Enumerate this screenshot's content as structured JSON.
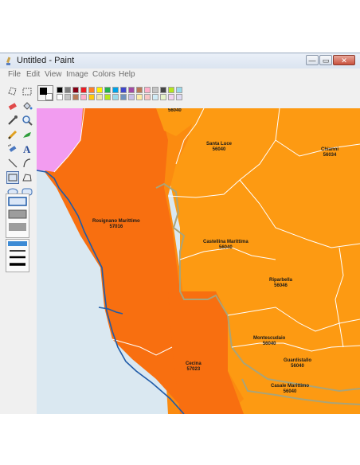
{
  "window": {
    "title": "Untitled - Paint",
    "controls": {
      "minimize": "—",
      "maximize": "▭",
      "close": "✕"
    }
  },
  "menu": [
    "File",
    "Edit",
    "View",
    "Image",
    "Colors",
    "Help"
  ],
  "palette": {
    "foreground": "#000000",
    "background": "#ffffff",
    "row1": [
      "#000000",
      "#7f7f7f",
      "#880015",
      "#ed1c24",
      "#ff7f27",
      "#fff200",
      "#22b14c",
      "#00a2e8",
      "#3f48cc",
      "#a349a4",
      "#b97a57",
      "#ffaec9",
      "#c3c3c3",
      "#464646",
      "#b5e61d",
      "#99d9ea"
    ],
    "row2": [
      "#ffffff",
      "#c3c3c3",
      "#b97a57",
      "#ffaec9",
      "#ffc90e",
      "#efe4b0",
      "#b5e61d",
      "#99d9ea",
      "#7092be",
      "#c8bfe7",
      "#fdeca6",
      "#f7c5c5",
      "#d0ecf7",
      "#e6f3c8",
      "#f2d2f0",
      "#ddd9f3"
    ]
  },
  "colors": {
    "sea": "#dae8f1",
    "pink": "#f29cf0",
    "dark_orange": "#f86f10",
    "mid_orange": "#fb8b10",
    "light_orange": "#fd9a12",
    "border_gray": "#a9a479",
    "border_white": "#ffffff",
    "coast_blue": "#1f5ba8"
  },
  "map": {
    "labels": [
      {
        "name": "Rosignano Marittimo",
        "code": "57016"
      },
      {
        "name": "Santa Luce",
        "code": "56040"
      },
      {
        "name": "Chianni",
        "code": "56034"
      },
      {
        "name": "Castellina Marittima",
        "code": "56040"
      },
      {
        "name": "Riparbella",
        "code": "56046"
      },
      {
        "name": "Montescudaio",
        "code": "56040"
      },
      {
        "name": "Guardistallo",
        "code": "56040"
      },
      {
        "name": "Casale Marittimo",
        "code": "56040"
      },
      {
        "name": "Cecina",
        "code": "57023"
      },
      {
        "name": "",
        "code": "56040"
      }
    ]
  }
}
